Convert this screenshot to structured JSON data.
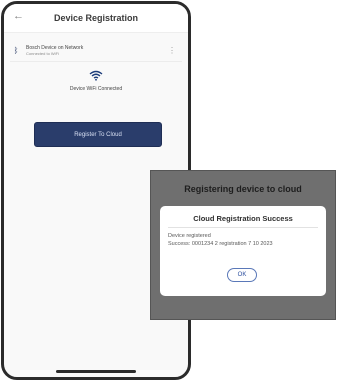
{
  "header": {
    "back_icon": "←",
    "title": "Device Registration"
  },
  "device": {
    "icon": "ᛒ",
    "name": "Bosch Device on Network",
    "sub": "Connected to WiFi",
    "more": "⋮"
  },
  "connection": {
    "wifi_icon": "wifi-icon",
    "status": "Device WiFi Connected"
  },
  "register_button": "Register To Cloud",
  "popup": {
    "status": "Registering device to cloud",
    "dialog_title": "Cloud Registration Success",
    "lines": [
      "Device registered",
      "Success: 0001234 2 registration 7 10 2023"
    ],
    "ok": "OK"
  }
}
